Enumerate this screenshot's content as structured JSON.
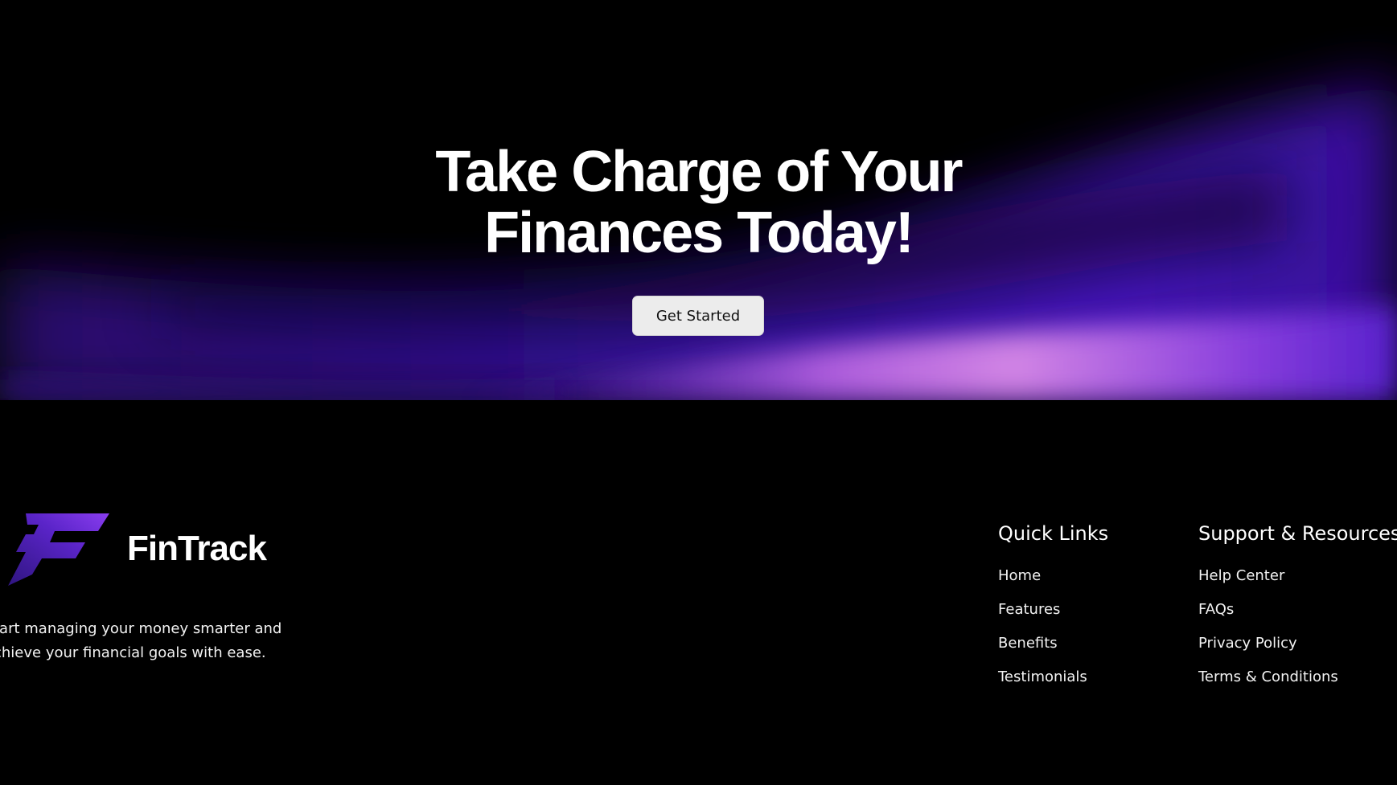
{
  "hero": {
    "title_line1": "Take Charge of Your",
    "title_line2": "Finances Today!",
    "cta_label": "Get Started"
  },
  "footer": {
    "brand": {
      "name": "FinTrack",
      "logo_icon": "fintrack-f-logo",
      "description": "tart managing your money smarter and chieve your financial goals with ease."
    },
    "quick_links": {
      "heading": "Quick Links",
      "items": [
        "Home",
        "Features",
        "Benefits",
        "Testimonials"
      ]
    },
    "support": {
      "heading": "Support & Resources",
      "items": [
        "Help Center",
        "FAQs",
        "Privacy Policy",
        "Terms & Conditions"
      ]
    }
  },
  "colors": {
    "background": "#000000",
    "accent_purple": "#6a2bd9",
    "glow_pink": "#d77ce6",
    "button_bg": "#ececec"
  }
}
